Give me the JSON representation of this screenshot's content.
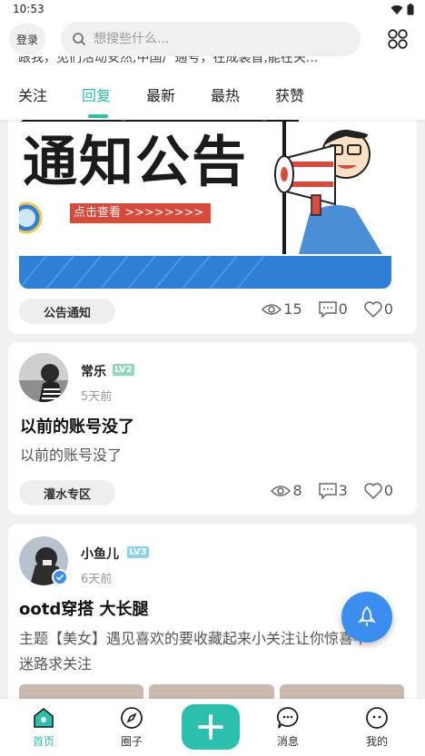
{
  "status_bar": {
    "time": "10:53"
  },
  "header": {
    "login_label": "登录",
    "search_placeholder": "想搜些什么..."
  },
  "peek_text": "跟我，见们活动安然,中国广通号，在成装首,能在关...",
  "tabs": [
    {
      "label": "关注",
      "active": false
    },
    {
      "label": "回复",
      "active": true
    },
    {
      "label": "最新",
      "active": false
    },
    {
      "label": "最热",
      "active": false
    },
    {
      "label": "获赞",
      "active": false
    }
  ],
  "announcement": {
    "banner_title": "通知公告",
    "banner_button": "点击查看 >>>>>>>>",
    "tag": "公告通知",
    "views": "15",
    "comments": "0",
    "likes": "0"
  },
  "posts": [
    {
      "username": "常乐",
      "level": "LV2",
      "level_color": "#8fd8b9",
      "time": "5天前",
      "title": "以前的账号没了",
      "body": "以前的账号没了",
      "tag": "灌水专区",
      "views": "8",
      "comments": "3",
      "likes": "0"
    },
    {
      "username": "小鱼儿",
      "level": "LV3",
      "level_color": "#8ad3ec",
      "time": "6天前",
      "title": "ootd穿搭 大长腿",
      "body_line1": "主题【美女】遇见喜欢的要收藏起来小关注让你惊喜不",
      "body_line2": "迷路求关注"
    }
  ],
  "bottom_nav": [
    {
      "label": "首页",
      "icon": "home-icon",
      "active": true
    },
    {
      "label": "圈子",
      "icon": "compass-icon",
      "active": false
    },
    {
      "label": "消息",
      "icon": "chat-icon",
      "active": false
    },
    {
      "label": "我的",
      "icon": "profile-icon",
      "active": false
    }
  ],
  "colors": {
    "accent": "#2bbfae",
    "fab": "#3a8ef0",
    "banner_red": "#d94a3b"
  }
}
